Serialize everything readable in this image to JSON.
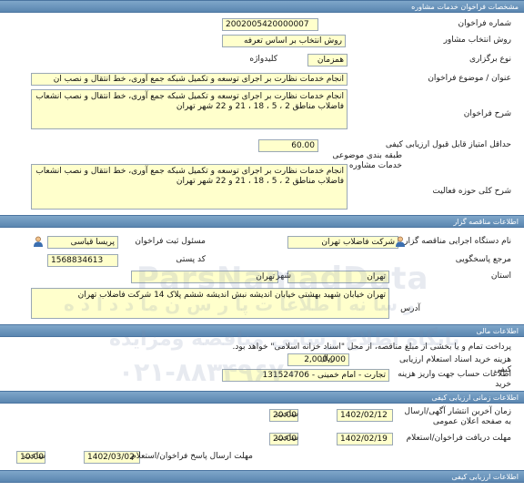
{
  "sections": {
    "details": "مشخصات فراخوان خدمات مشاوره",
    "tender_info": "اطلاعات مناقصه گزار",
    "financial": "اطلاعات مالی",
    "timing": "اطلاعات زمانی ارزیابی کیفی",
    "evaluation": "اطلاعات ارزیابی کیفی"
  },
  "details": {
    "call_number_label": "شماره فراخوان",
    "call_number": "2002005420000007",
    "method_label": "روش انتخاب مشاور",
    "method": "روش انتخاب بر اساس تعرفه",
    "type_label": "نوع برگزاری",
    "type": "همزمان",
    "keyword_label": "کلیدواژه",
    "keyword": "",
    "title_label": "عنوان / موضوع فراخوان",
    "title": "انجام خدمات نظارت بر اجرای توسعه و تکمیل شبکه جمع آوری، خط انتقال و نصب ان",
    "description_label": "شرح فراخوان",
    "description": "انجام خدمات نظارت بر اجرای توسعه و تکمیل شبکه جمع آوری، خط انتقال و نصب انشعاب فاضلاب مناطق 2 ، 5 ، 18 ، 21 و 22 شهر تهران",
    "min_score_label": "حداقل امتیاز قابل قبول ارزیابی کیفی",
    "min_score": "60.00",
    "category_label": "طبقه بندی موضوعی",
    "category": "خدمات مشاوره",
    "scope_label": "شرح کلی حوزه فعالیت",
    "scope": "انجام خدمات نظارت بر اجرای توسعه و تکمیل شبکه جمع آوری، خط انتقال و نصب انشعاب فاضلاب مناطق 2 ، 5 ، 18 ، 21 و 22 شهر تهران"
  },
  "tender": {
    "org_label": "نام دستگاه اجرایی مناقصه گزار",
    "org": "شرکت فاضلاب تهران",
    "registrar_label": "مسئول ثبت فراخوان",
    "registrar": "پریسا  قیاسی",
    "reference_label": "مرجع پاسخگویی",
    "reference": "",
    "postal_label": "کد پستی",
    "postal": "1568834613",
    "province_label": "استان",
    "province": "تهران",
    "city_label": "شهر",
    "city": "تهران",
    "address_label": "آدرس",
    "address": "تهران خیابان شهید بهشتی خیابان اندیشه نبش اندیشه ششم پلاک 14 شرکت فاضلاب تهران"
  },
  "financial": {
    "note": "پرداخت تمام و یا بخشی از مبلغ مناقصه، از محل \"اسناد خزانه اسلامی\" خواهد بود.",
    "doc_cost_label": "هزینه خرید اسناد استعلام ارزیابی کیفی",
    "doc_cost": "2,000,000",
    "currency": "ریال",
    "account_label": "اطلاعات حساب جهت واریز هزینه خرید",
    "account": "تجارت - امام خمینی - 131524706"
  },
  "timing": {
    "last_publish_label": "زمان آخرین انتشار آگهی/ارسال به صفحه اعلان عمومی",
    "last_publish_date": "1402/02/12",
    "last_publish_time": "20:00",
    "receive_deadline_label": "مهلت دریافت فراخوان/استعلام",
    "receive_deadline_date": "1402/02/19",
    "receive_deadline_time": "20:00",
    "submit_deadline_label": "مهلت ارسال پاسخ فراخوان/استعلام",
    "submit_deadline_date": "1402/03/02",
    "submit_deadline_time": "10:00",
    "time_label": "ساعت"
  },
  "watermark": {
    "brand": "ParsNamadData",
    "line1": "ر سا نه ا طلاعا ت پا ر س ن ما د د ا د ه",
    "line2": "پایگاه اطلاع رسانی مناقصه ومزایده",
    "phone": "۰۲۱-۸۸۳۴۹۶۷۰"
  }
}
